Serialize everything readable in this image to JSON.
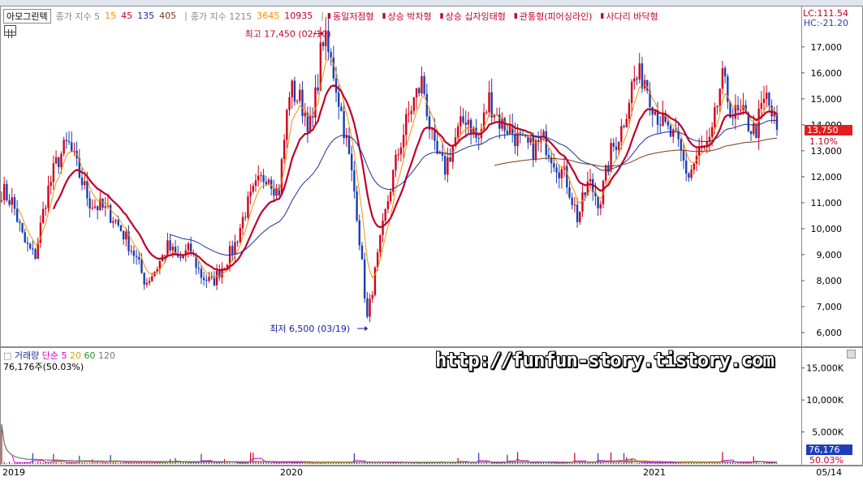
{
  "header": {
    "stock_name": "아모그린텍",
    "ma_label": "종가 지수 5",
    "ma_periods": [
      "15",
      "45",
      "135",
      "405"
    ],
    "ma_colors": [
      "#ff8c00",
      "#c0002a",
      "#1f2f9f",
      "#7a3a1a"
    ],
    "ma2_label": "종가 지수 1215",
    "ma2_periods": [
      "3645",
      "10935"
    ],
    "ma2_colors": [
      "#ff8c00",
      "#c0002a"
    ],
    "patterns": [
      "동일저점형",
      "상승 박차형",
      "상승 십자잉태형",
      "관통형(피어싱라인)",
      "사다리 바닥형"
    ],
    "lc": "LC:111.54",
    "hc": "HC:-21.20"
  },
  "price_pane": {
    "current_price": "13,750",
    "change_pct": "1.10%",
    "high_annotation": "최고 17,450 (02/10)",
    "low_annotation": "최저 6,500 (03/19)",
    "colors": {
      "up": "#d0021b",
      "down": "#1a3fb0",
      "price_badge": "#e31e1e"
    }
  },
  "volume_pane": {
    "legend_title": "거래량",
    "legend_ma_label": "단순 5",
    "legend_periods": [
      "20",
      "60",
      "120"
    ],
    "legend_colors": [
      "#cc00cc",
      "#d4a017",
      "#2e8b2e",
      "#777777"
    ],
    "value_text": "76,176주(50.03%)",
    "watermark": "http://funfun-story.tistory.com",
    "current_volume": "76,176",
    "volume_pct": "50.03%"
  },
  "x_axis": {
    "labels": [
      "2019",
      "2020",
      "2021"
    ],
    "last_date": "05/14"
  },
  "chart_data": [
    {
      "type": "candlestick",
      "title": "아모그린텍",
      "ylim": [
        5500,
        17900
      ],
      "y_ticks": [
        "6,000",
        "7,000",
        "8,000",
        "9,000",
        "10,000",
        "11,000",
        "12,000",
        "13,000",
        "14,000",
        "15,000",
        "16,000",
        "17,000"
      ],
      "x": [
        "2019",
        "2020",
        "2021"
      ],
      "close_path_approx": [
        11500,
        11000,
        9500,
        8900,
        11200,
        12600,
        13300,
        12100,
        11000,
        10800,
        10500,
        9800,
        9000,
        7900,
        8500,
        9300,
        8800,
        9200,
        8200,
        7900,
        8600,
        9300,
        10700,
        11600,
        12200,
        11300,
        15400,
        14900,
        13800,
        17450,
        16000,
        13700,
        11000,
        6500,
        9000,
        11400,
        13300,
        14700,
        15700,
        13000,
        12300,
        13500,
        14400,
        13300,
        15000,
        14100,
        13800,
        13200,
        13100,
        13400,
        12600,
        11900,
        10400,
        11800,
        11000,
        12900,
        13900,
        15700,
        15900,
        14600,
        13800,
        13300,
        12000,
        13000,
        13200,
        15800,
        14400,
        14300,
        13700,
        15100,
        13750
      ],
      "series": [
        {
          "name": "15",
          "color": "#ff8c00"
        },
        {
          "name": "45",
          "color": "#c0002a"
        },
        {
          "name": "135",
          "color": "#1f2f9f"
        },
        {
          "name": "405",
          "color": "#7a3a1a"
        }
      ],
      "annotations": [
        "최고 17,450 (02/10)",
        "최저 6,500 (03/19)"
      ]
    },
    {
      "type": "bar",
      "title": "거래량",
      "ylim": [
        0,
        18000
      ],
      "y_unit": "K",
      "y_ticks": [
        "5,000K",
        "10,000K",
        "15,000K"
      ],
      "current_value": "76,176주(50.03%)",
      "series": [
        {
          "name": "단순 5",
          "color": "#cc00cc"
        },
        {
          "name": "20",
          "color": "#d4a017"
        },
        {
          "name": "60",
          "color": "#2e8b2e"
        },
        {
          "name": "120",
          "color": "#777777"
        }
      ]
    }
  ]
}
